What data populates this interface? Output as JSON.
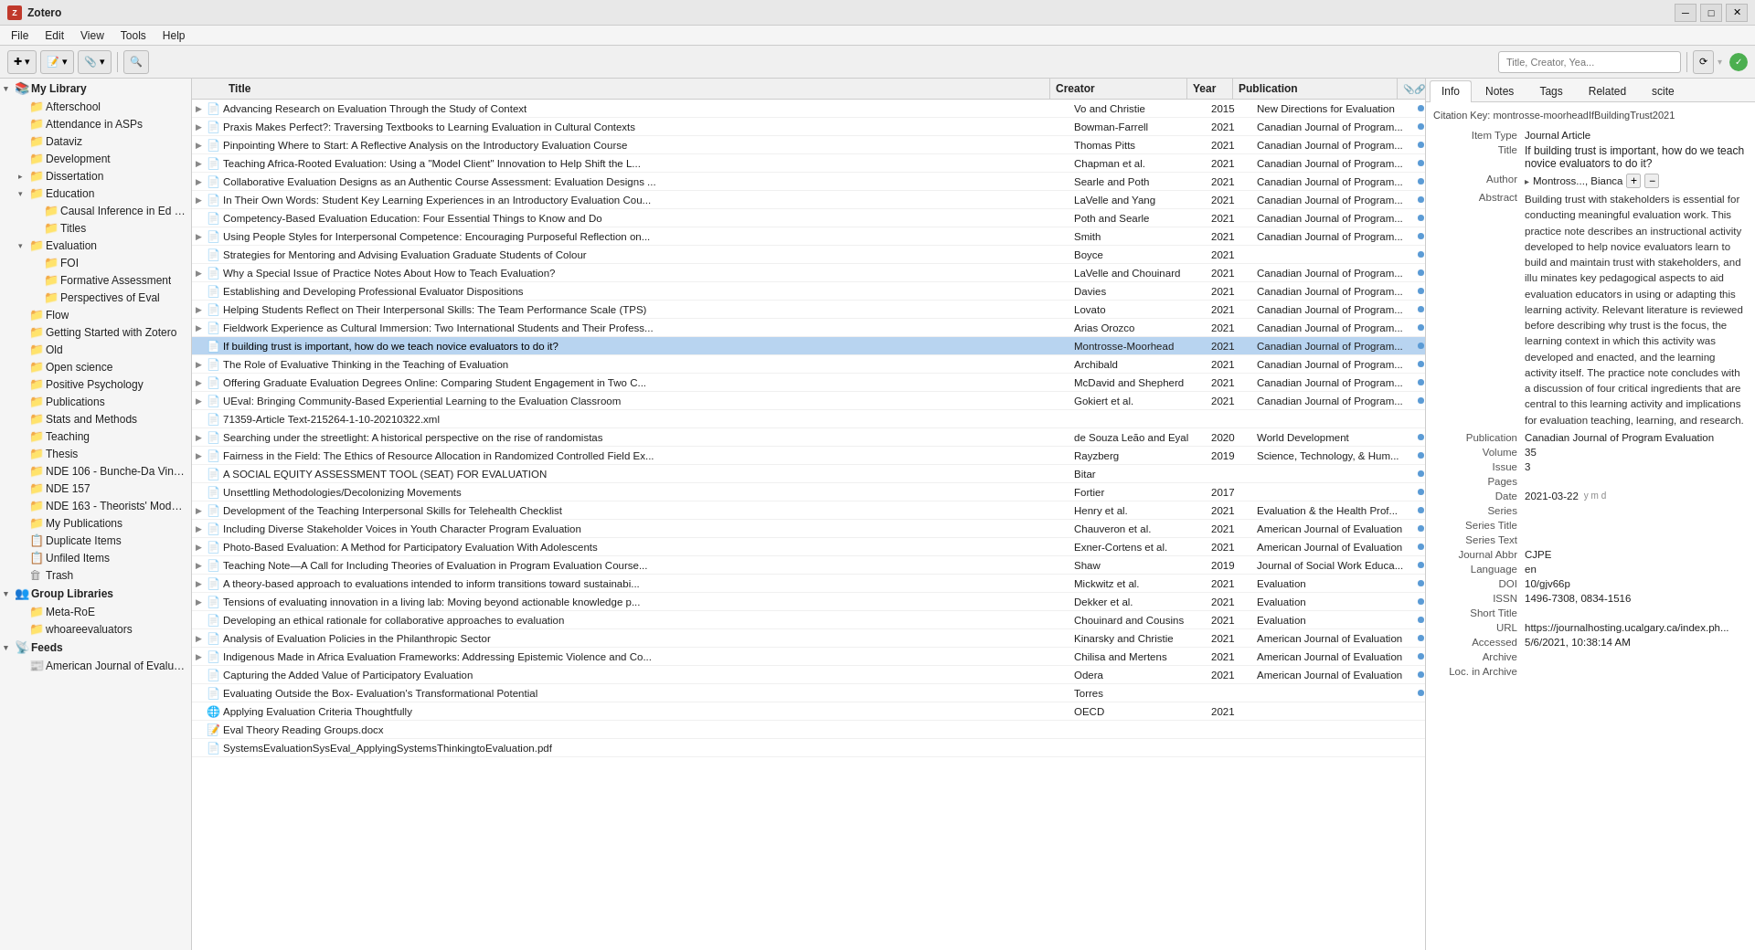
{
  "app": {
    "title": "Zotero",
    "window_controls": [
      "minimize",
      "maximize",
      "close"
    ]
  },
  "menubar": {
    "items": [
      "File",
      "Edit",
      "View",
      "Tools",
      "Help"
    ]
  },
  "toolbar": {
    "new_item_label": "New Item",
    "search_placeholder": "Title, Creator, Yea...",
    "sync_btn": "Sync"
  },
  "left_panel": {
    "sections": [
      {
        "label": "My Library",
        "type": "root",
        "expanded": true,
        "children": [
          {
            "label": "Afterschool",
            "type": "collection",
            "indent": 1
          },
          {
            "label": "Attendance in ASPs",
            "type": "collection",
            "indent": 1
          },
          {
            "label": "Dataviz",
            "type": "collection",
            "indent": 1
          },
          {
            "label": "Development",
            "type": "collection",
            "indent": 1
          },
          {
            "label": "Dissertation",
            "type": "collection",
            "indent": 1,
            "expanded": false
          },
          {
            "label": "Education",
            "type": "collection",
            "indent": 1,
            "expanded": true
          },
          {
            "label": "Causal Inference in Ed Polic...",
            "type": "collection",
            "indent": 2
          },
          {
            "label": "Titles",
            "type": "collection",
            "indent": 2
          },
          {
            "label": "Evaluation",
            "type": "collection",
            "indent": 1,
            "expanded": true
          },
          {
            "label": "FOI",
            "type": "collection",
            "indent": 2
          },
          {
            "label": "Formative Assessment",
            "type": "collection",
            "indent": 2
          },
          {
            "label": "Perspectives of Eval",
            "type": "collection",
            "indent": 2
          },
          {
            "label": "Flow",
            "type": "collection",
            "indent": 1
          },
          {
            "label": "Getting Started with Zotero",
            "type": "collection",
            "indent": 1
          },
          {
            "label": "Old",
            "type": "collection",
            "indent": 1
          },
          {
            "label": "Open science",
            "type": "collection",
            "indent": 1
          },
          {
            "label": "Positive Psychology",
            "type": "collection",
            "indent": 1
          },
          {
            "label": "Publications",
            "type": "collection",
            "indent": 1
          },
          {
            "label": "Stats and Methods",
            "type": "collection",
            "indent": 1
          },
          {
            "label": "Teaching",
            "type": "collection",
            "indent": 1
          },
          {
            "label": "Thesis",
            "type": "collection",
            "indent": 1
          },
          {
            "label": "NDE 106 - Bunche-Da Vinci ...",
            "type": "collection",
            "indent": 1
          },
          {
            "label": "NDE 157",
            "type": "collection",
            "indent": 1
          },
          {
            "label": "NDE 163 - Theorists' Models ...",
            "type": "collection",
            "indent": 1
          },
          {
            "label": "My Publications",
            "type": "collection",
            "indent": 1
          },
          {
            "label": "Duplicate Items",
            "type": "special",
            "indent": 1
          },
          {
            "label": "Unfiled Items",
            "type": "special",
            "indent": 1
          },
          {
            "label": "Trash",
            "type": "special",
            "indent": 1
          }
        ]
      },
      {
        "label": "Group Libraries",
        "type": "group-root",
        "expanded": true,
        "children": [
          {
            "label": "Meta-RoE",
            "type": "group",
            "indent": 1
          },
          {
            "label": "whoareevaluators",
            "type": "group",
            "indent": 1
          }
        ]
      },
      {
        "label": "Feeds",
        "type": "feeds-root",
        "expanded": true,
        "children": [
          {
            "label": "American Journal of Evaluation",
            "type": "feed",
            "indent": 1
          }
        ]
      }
    ]
  },
  "columns": {
    "title": "Title",
    "creator": "Creator",
    "year": "Year",
    "publication": "Publication"
  },
  "items": [
    {
      "id": 1,
      "arrow": "▶",
      "type": "article",
      "title": "Advancing Research on Evaluation Through the Study of Context",
      "creator": "Vo and Christie",
      "year": "2015",
      "publication": "New Directions for Evaluation",
      "dot": true,
      "dot_color": "blue"
    },
    {
      "id": 2,
      "arrow": "▶",
      "type": "article",
      "title": "Praxis Makes Perfect?: Traversing Textbooks to Learning Evaluation in Cultural Contexts",
      "creator": "Bowman-Farrell",
      "year": "2021",
      "publication": "Canadian Journal of Program...",
      "dot": true,
      "dot_color": "blue"
    },
    {
      "id": 3,
      "arrow": "▶",
      "type": "article",
      "title": "Pinpointing Where to Start: A Reflective Analysis on the Introductory Evaluation Course",
      "creator": "Thomas Pitts",
      "year": "2021",
      "publication": "Canadian Journal of Program...",
      "dot": true,
      "dot_color": "blue"
    },
    {
      "id": 4,
      "arrow": "▶",
      "type": "article",
      "title": "Teaching Africa-Rooted Evaluation: Using a \"Model Client\" Innovation to Help Shift the L...",
      "creator": "Chapman et al.",
      "year": "2021",
      "publication": "Canadian Journal of Program...",
      "dot": true,
      "dot_color": "blue"
    },
    {
      "id": 5,
      "arrow": "▶",
      "type": "article",
      "title": "Collaborative Evaluation Designs as an Authentic Course Assessment: Evaluation Designs ...",
      "creator": "Searle and Poth",
      "year": "2021",
      "publication": "Canadian Journal of Program...",
      "dot": true,
      "dot_color": "blue"
    },
    {
      "id": 6,
      "arrow": "▶",
      "type": "article",
      "title": "In Their Own Words: Student Key Learning Experiences in an Introductory Evaluation Cou...",
      "creator": "LaVelle and Yang",
      "year": "2021",
      "publication": "Canadian Journal of Program...",
      "dot": true,
      "dot_color": "blue"
    },
    {
      "id": 7,
      "arrow": "",
      "type": "article",
      "title": "Competency-Based Evaluation Education: Four Essential Things to Know and Do",
      "creator": "Poth and Searle",
      "year": "2021",
      "publication": "Canadian Journal of Program...",
      "dot": true,
      "dot_color": "blue"
    },
    {
      "id": 8,
      "arrow": "▶",
      "type": "article",
      "title": "Using People Styles for Interpersonal Competence: Encouraging Purposeful Reflection on...",
      "creator": "Smith",
      "year": "2021",
      "publication": "Canadian Journal of Program...",
      "dot": true,
      "dot_color": "blue"
    },
    {
      "id": 9,
      "arrow": "",
      "type": "article",
      "title": "Strategies for Mentoring and Advising Evaluation Graduate Students of Colour",
      "creator": "Boyce",
      "year": "2021",
      "publication": "",
      "dot": true,
      "dot_color": "blue"
    },
    {
      "id": 10,
      "arrow": "▶",
      "type": "article",
      "title": "Why a Special Issue of Practice Notes About How to Teach Evaluation?",
      "creator": "LaVelle and Chouinard",
      "year": "2021",
      "publication": "Canadian Journal of Program...",
      "dot": true,
      "dot_color": "blue"
    },
    {
      "id": 11,
      "arrow": "",
      "type": "article",
      "title": "Establishing and Developing Professional Evaluator Dispositions",
      "creator": "Davies",
      "year": "2021",
      "publication": "Canadian Journal of Program...",
      "dot": true,
      "dot_color": "blue"
    },
    {
      "id": 12,
      "arrow": "▶",
      "type": "article",
      "title": "Helping Students Reflect on Their Interpersonal Skills: The Team Performance Scale (TPS)",
      "creator": "Lovato",
      "year": "2021",
      "publication": "Canadian Journal of Program...",
      "dot": true,
      "dot_color": "blue"
    },
    {
      "id": 13,
      "arrow": "▶",
      "type": "article",
      "title": "Fieldwork Experience as Cultural Immersion: Two International Students and Their Profess...",
      "creator": "Arias Orozco",
      "year": "2021",
      "publication": "Canadian Journal of Program...",
      "dot": true,
      "dot_color": "blue"
    },
    {
      "id": 14,
      "arrow": "",
      "type": "article",
      "title": "If building trust is important, how do we teach novice evaluators to do it?",
      "creator": "Montrosse-Moorhead",
      "year": "2021",
      "publication": "Canadian Journal of Program...",
      "dot": true,
      "dot_color": "blue",
      "selected": true
    },
    {
      "id": 15,
      "arrow": "▶",
      "type": "article",
      "title": "The Role of Evaluative Thinking in the Teaching of Evaluation",
      "creator": "Archibald",
      "year": "2021",
      "publication": "Canadian Journal of Program...",
      "dot": true,
      "dot_color": "blue"
    },
    {
      "id": 16,
      "arrow": "▶",
      "type": "article",
      "title": "Offering Graduate Evaluation Degrees Online: Comparing Student Engagement in Two C...",
      "creator": "McDavid and Shepherd",
      "year": "2021",
      "publication": "Canadian Journal of Program...",
      "dot": true,
      "dot_color": "blue"
    },
    {
      "id": 17,
      "arrow": "▶",
      "type": "article",
      "title": "UEval: Bringing Community-Based Experiential Learning to the Evaluation Classroom",
      "creator": "Gokiert et al.",
      "year": "2021",
      "publication": "Canadian Journal of Program...",
      "dot": true,
      "dot_color": "blue"
    },
    {
      "id": 18,
      "arrow": "",
      "type": "xml",
      "title": "71359-Article Text-215264-1-10-20210322.xml",
      "creator": "",
      "year": "",
      "publication": "",
      "dot": false
    },
    {
      "id": 19,
      "arrow": "▶",
      "type": "article",
      "title": "Searching under the streetlight: A historical perspective on the rise of randomistas",
      "creator": "de Souza Leão and Eyal",
      "year": "2020",
      "publication": "World Development",
      "dot": true,
      "dot_color": "blue"
    },
    {
      "id": 20,
      "arrow": "▶",
      "type": "article",
      "title": "Fairness in the Field: The Ethics of Resource Allocation in Randomized Controlled Field Ex...",
      "creator": "Rayzberg",
      "year": "2019",
      "publication": "Science, Technology, & Hum...",
      "dot": true,
      "dot_color": "blue"
    },
    {
      "id": 21,
      "arrow": "",
      "type": "article",
      "title": "A SOCIAL EQUITY ASSESSMENT TOOL (SEAT) FOR EVALUATION",
      "creator": "Bitar",
      "year": "",
      "publication": "",
      "dot": true,
      "dot_color": "blue"
    },
    {
      "id": 22,
      "arrow": "",
      "type": "article",
      "title": "Unsettling Methodologies/Decolonizing Movements",
      "creator": "Fortier",
      "year": "2017",
      "publication": "",
      "dot": true,
      "dot_color": "blue"
    },
    {
      "id": 23,
      "arrow": "▶",
      "type": "article",
      "title": "Development of the Teaching Interpersonal Skills for Telehealth Checklist",
      "creator": "Henry et al.",
      "year": "2021",
      "publication": "Evaluation & the Health Prof...",
      "dot": true,
      "dot_color": "blue"
    },
    {
      "id": 24,
      "arrow": "▶",
      "type": "article",
      "title": "Including Diverse Stakeholder Voices in Youth Character Program Evaluation",
      "creator": "Chauveron et al.",
      "year": "2021",
      "publication": "American Journal of Evaluation",
      "dot": true,
      "dot_color": "blue"
    },
    {
      "id": 25,
      "arrow": "▶",
      "type": "article",
      "title": "Photo-Based Evaluation: A Method for Participatory Evaluation With Adolescents",
      "creator": "Exner-Cortens et al.",
      "year": "2021",
      "publication": "American Journal of Evaluation",
      "dot": true,
      "dot_color": "blue"
    },
    {
      "id": 26,
      "arrow": "▶",
      "type": "article",
      "title": "Teaching Note—A Call for Including Theories of Evaluation in Program Evaluation Course...",
      "creator": "Shaw",
      "year": "2019",
      "publication": "Journal of Social Work Educa...",
      "dot": true,
      "dot_color": "blue"
    },
    {
      "id": 27,
      "arrow": "▶",
      "type": "article",
      "title": "A theory-based approach to evaluations intended to inform transitions toward sustainabi...",
      "creator": "Mickwitz et al.",
      "year": "2021",
      "publication": "Evaluation",
      "dot": true,
      "dot_color": "blue"
    },
    {
      "id": 28,
      "arrow": "▶",
      "type": "article",
      "title": "Tensions of evaluating innovation in a living lab: Moving beyond actionable knowledge p...",
      "creator": "Dekker et al.",
      "year": "2021",
      "publication": "Evaluation",
      "dot": true,
      "dot_color": "blue"
    },
    {
      "id": 29,
      "arrow": "",
      "type": "article",
      "title": "Developing an ethical rationale for collaborative approaches to evaluation",
      "creator": "Chouinard and Cousins",
      "year": "2021",
      "publication": "Evaluation",
      "dot": true,
      "dot_color": "blue"
    },
    {
      "id": 30,
      "arrow": "▶",
      "type": "article",
      "title": "Analysis of Evaluation Policies in the Philanthropic Sector",
      "creator": "Kinarsky and Christie",
      "year": "2021",
      "publication": "American Journal of Evaluation",
      "dot": true,
      "dot_color": "blue"
    },
    {
      "id": 31,
      "arrow": "▶",
      "type": "article",
      "title": "Indigenous Made in Africa Evaluation Frameworks: Addressing Epistemic Violence and Co...",
      "creator": "Chilisa and Mertens",
      "year": "2021",
      "publication": "American Journal of Evaluation",
      "dot": true,
      "dot_color": "blue"
    },
    {
      "id": 32,
      "arrow": "",
      "type": "article",
      "title": "Capturing the Added Value of Participatory Evaluation",
      "creator": "Odera",
      "year": "2021",
      "publication": "American Journal of Evaluation",
      "dot": true,
      "dot_color": "blue"
    },
    {
      "id": 33,
      "arrow": "",
      "type": "article",
      "title": "Evaluating Outside the Box- Evaluation's Transformational Potential",
      "creator": "Torres",
      "year": "",
      "publication": "",
      "dot": true,
      "dot_color": "blue"
    },
    {
      "id": 34,
      "arrow": "",
      "type": "webpage",
      "title": "Applying Evaluation Criteria Thoughtfully",
      "creator": "OECD",
      "year": "2021",
      "publication": "",
      "dot": false,
      "selected_partial": true
    },
    {
      "id": 35,
      "arrow": "",
      "type": "doc",
      "title": "Eval Theory Reading Groups.docx",
      "creator": "",
      "year": "",
      "publication": "",
      "dot": false
    },
    {
      "id": 36,
      "arrow": "",
      "type": "pdf",
      "title": "SystemsEvaluationSysEval_ApplyingSystemsThinkingtoEvaluation.pdf",
      "creator": "",
      "year": "",
      "publication": "",
      "dot": false
    }
  ],
  "right_panel": {
    "tabs": [
      "Info",
      "Notes",
      "Tags",
      "Related",
      "scite"
    ],
    "active_tab": "Info",
    "citation_key": "Citation Key: montrosse-moorheadIfBuildingTrust2021",
    "fields": [
      {
        "label": "Item Type",
        "value": "Journal Article"
      },
      {
        "label": "Title",
        "value": "If building trust is important, how do we teach novice evaluators to do it?",
        "is_title": true
      },
      {
        "label": "Author",
        "value": "Montross..., Bianca",
        "has_controls": true
      },
      {
        "label": "Abstract",
        "value": "Building trust with stakeholders is essential for conducting meaningful evaluation work. This practice note describes an instructional activity developed to help novice evaluators learn to build and maintain trust with stakeholders, and illu minates key pedagogical aspects to aid evaluation educators in using or adapting this learning activity. Relevant literature is reviewed before describing why trust is the focus, the learning context in which this activity was developed and enacted, and the learning activity itself. The practice note concludes with a discussion of four critical ingredients that are central to this learning activity and implications for evaluation teaching, learning, and research.",
        "is_abstract": true
      },
      {
        "label": "Publication",
        "value": "Canadian Journal of Program Evaluation"
      },
      {
        "label": "Volume",
        "value": "35"
      },
      {
        "label": "Issue",
        "value": "3"
      },
      {
        "label": "Pages",
        "value": ""
      },
      {
        "label": "Date",
        "value": "2021-03-22",
        "has_ymd": true
      },
      {
        "label": "Series",
        "value": ""
      },
      {
        "label": "Series Title",
        "value": ""
      },
      {
        "label": "Series Text",
        "value": ""
      },
      {
        "label": "Journal Abbr",
        "value": "CJPE"
      },
      {
        "label": "Language",
        "value": "en"
      },
      {
        "label": "DOI",
        "value": "10/gjv66p"
      },
      {
        "label": "ISSN",
        "value": "1496-7308, 0834-1516"
      },
      {
        "label": "Short Title",
        "value": ""
      },
      {
        "label": "URL",
        "value": "https://journalhosting.ucalgary.ca/index.ph..."
      },
      {
        "label": "Accessed",
        "value": "5/6/2021, 10:38:14 AM"
      },
      {
        "label": "Archive",
        "value": ""
      },
      {
        "label": "Loc. in Archive",
        "value": ""
      }
    ]
  }
}
